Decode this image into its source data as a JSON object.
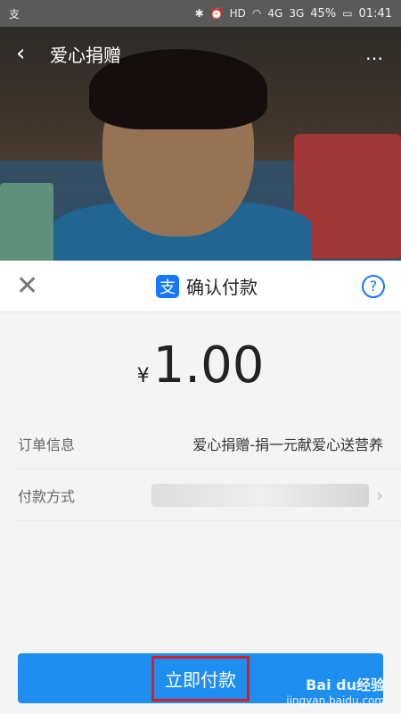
{
  "status_bar": {
    "battery": "45%",
    "time": "01:41",
    "icons": [
      "alipay-icon",
      "bluetooth-icon",
      "alarm-icon",
      "hd-icon",
      "wifi-icon",
      "signal-4g-icon",
      "signal-3g-icon",
      "battery-icon"
    ],
    "hd_label": "HD",
    "net1_label": "4G",
    "net2_label": "3G"
  },
  "header": {
    "title": "爱心捐赠",
    "more_label": "…"
  },
  "sheet": {
    "title": "确认付款",
    "amount_currency": "¥",
    "amount": "1.00",
    "order_label": "订单信息",
    "order_value": "爱心捐赠-捐一元献爱心送营养",
    "method_label": "付款方式",
    "pay_button": "立即付款"
  },
  "watermark": {
    "line1": "Bai du经验",
    "line2": "jingyan.baidu.com"
  },
  "colors": {
    "accent": "#1e8ef0",
    "alipay_blue": "#1677ff",
    "highlight_red": "#d1202a"
  }
}
